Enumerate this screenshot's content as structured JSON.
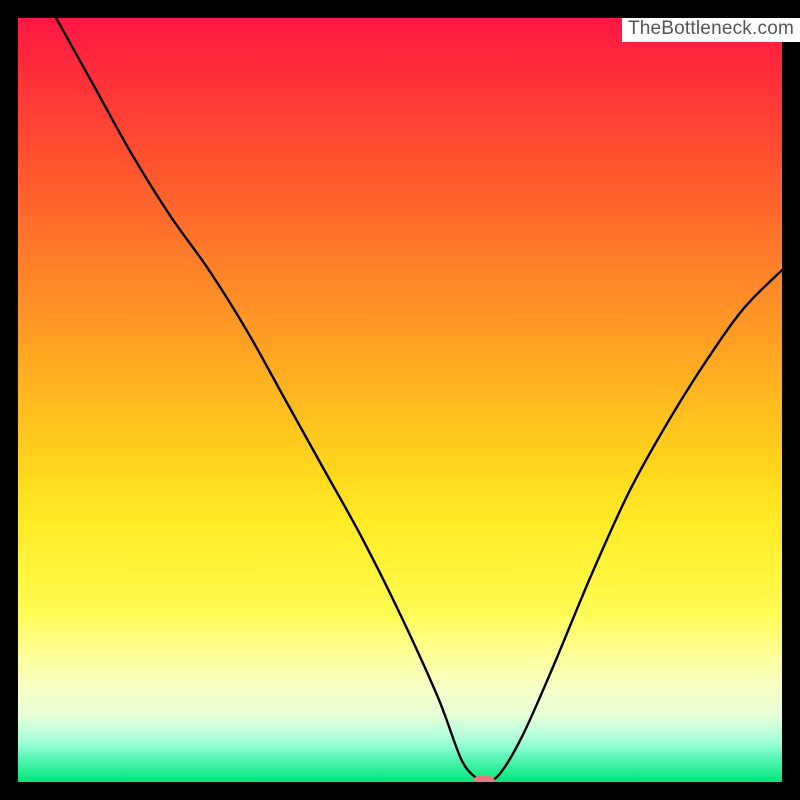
{
  "watermark": "TheBottleneck.com",
  "gradient_colors": {
    "top": "#ff1744",
    "mid_upper": "#ff8c27",
    "mid": "#ffeb28",
    "mid_lower": "#fdffa0",
    "bottom": "#00e676"
  },
  "curve_stroke": "#000000",
  "marker_color": "#e37b7b",
  "chart_data": {
    "type": "line",
    "title": "",
    "xlabel": "",
    "ylabel": "",
    "xlim": [
      0,
      100
    ],
    "ylim": [
      0,
      100
    ],
    "grid": false,
    "series": [
      {
        "name": "bottleneck-curve",
        "x": [
          5,
          10,
          15,
          20,
          25,
          30,
          35,
          40,
          45,
          50,
          55,
          58,
          60,
          61,
          63,
          66,
          70,
          75,
          80,
          85,
          90,
          95,
          100
        ],
        "y": [
          100,
          91,
          82,
          74,
          67,
          59,
          50,
          41,
          32,
          22,
          11,
          3,
          0.5,
          0,
          1,
          6,
          15,
          27,
          38,
          47,
          55,
          62,
          67
        ]
      }
    ],
    "marker": {
      "x": 61,
      "y": 0
    },
    "legend": false
  }
}
